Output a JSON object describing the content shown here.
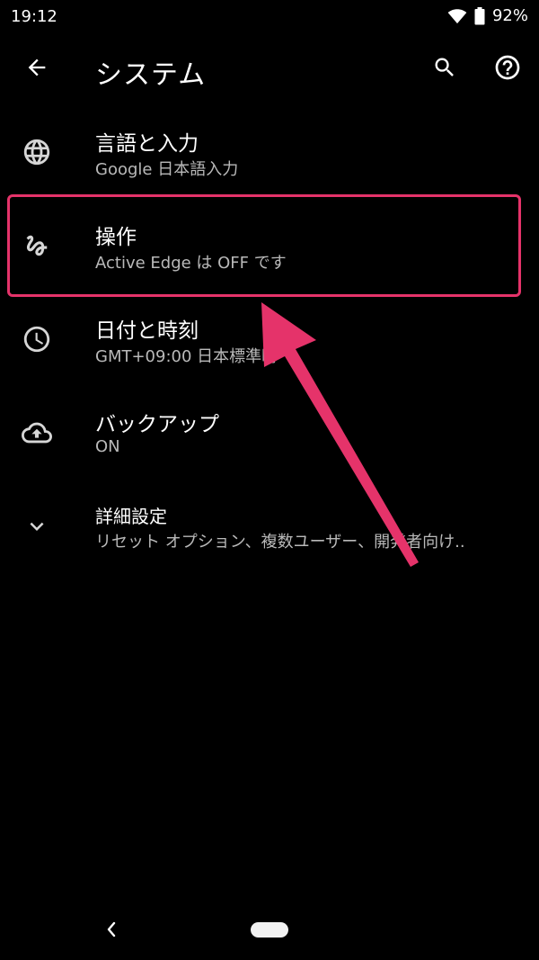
{
  "status_bar": {
    "time": "19:12",
    "battery_percent": "92%",
    "icons": [
      "wifi-icon",
      "battery-icon"
    ]
  },
  "app_bar": {
    "title": "システム",
    "icons": [
      "back-arrow-icon",
      "search-icon",
      "help-icon"
    ]
  },
  "settings": {
    "items": [
      {
        "title": "言語と入力",
        "subtitle": "Google 日本語入力",
        "icon": "globe-icon"
      },
      {
        "title": "操作",
        "subtitle": "Active Edge は OFF です",
        "icon": "gesture-icon"
      },
      {
        "title": "日付と時刻",
        "subtitle": "GMT+09:00 日本標準時",
        "icon": "clock-icon"
      },
      {
        "title": "バックアップ",
        "subtitle": "ON",
        "icon": "cloud-upload-icon"
      },
      {
        "title": "詳細設定",
        "subtitle": "リセット オプション、複数ユーザー、開発者向け..",
        "icon": "chevron-down-icon"
      }
    ]
  },
  "annotation": {
    "color": "#e5336a",
    "highlighted_item": "操作"
  },
  "nav_bar": {
    "icons": [
      "nav-back-icon",
      "home-pill"
    ]
  }
}
